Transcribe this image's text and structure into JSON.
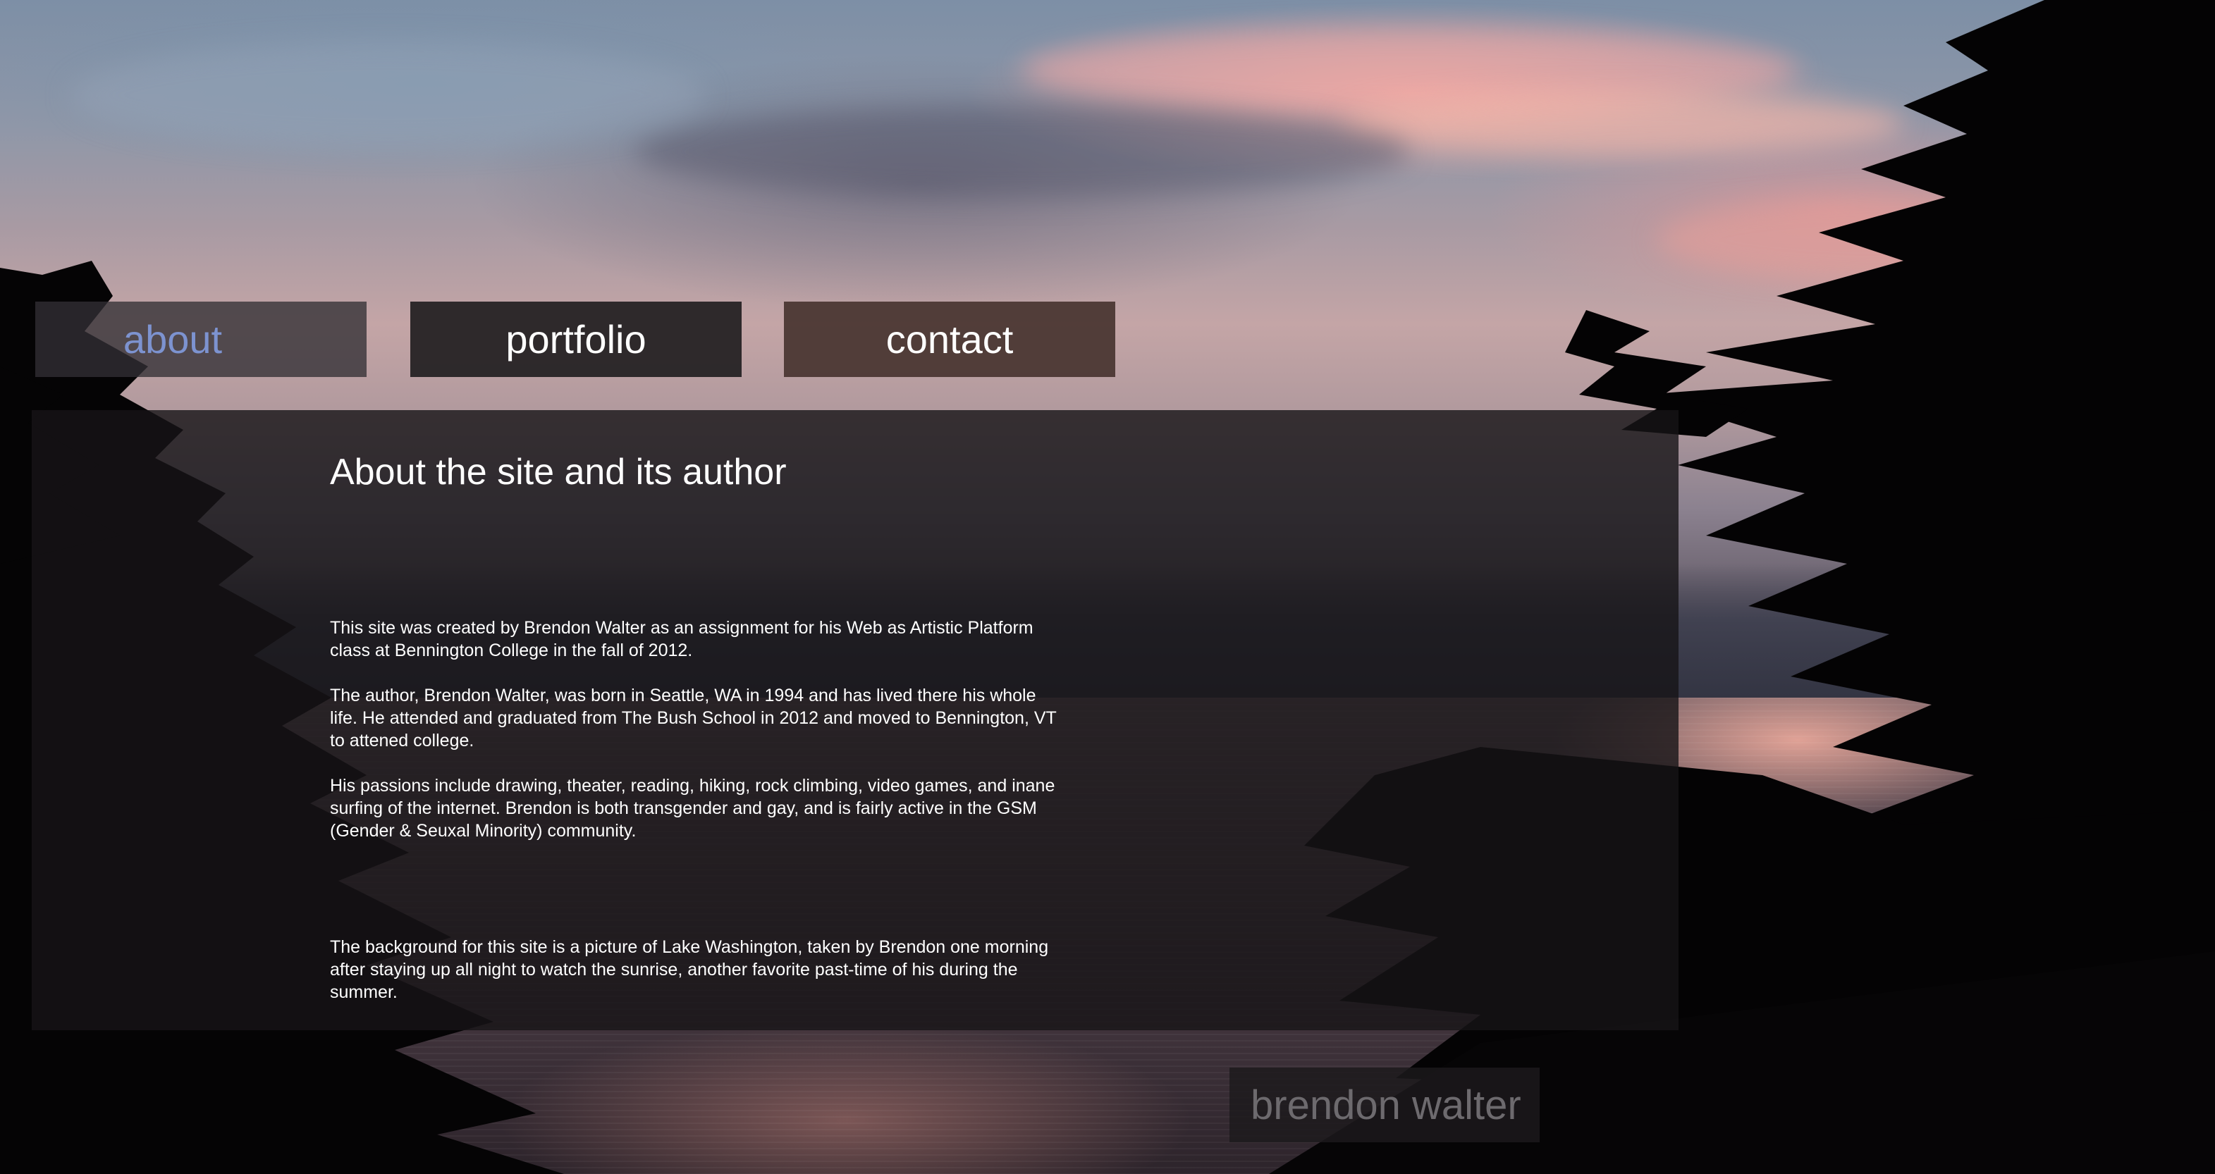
{
  "nav": {
    "items": [
      {
        "label": "about",
        "active": true
      },
      {
        "label": "portfolio",
        "active": false
      },
      {
        "label": "contact",
        "active": false
      }
    ],
    "active_color": "#7d93d0",
    "default_color": "#ffffff"
  },
  "content": {
    "title": "About the site and its author",
    "paragraphs": [
      "This site was created by Brendon Walter as an assignment for his Web as Artistic Platform class at Bennington College in the fall of 2012.",
      "The author, Brendon Walter, was born in Seattle, WA in 1994 and has lived there his whole life. He attended and graduated from The Bush School in 2012 and moved to Bennington, VT to attened college.",
      "His passions include drawing, theater, reading, hiking, rock climbing, video games, and inane surfing of the internet. Brendon is both transgender and gay, and is fairly active in the GSM (Gender & Seuxal Minority) community.",
      "The background for this site is a picture of Lake Washington, taken by Brendon one morning after staying up all night to watch the sunrise, another favorite past-time of his during the summer."
    ]
  },
  "footer": {
    "name": "brendon walter"
  },
  "background": {
    "subject": "sunrise-over-lake-photo"
  }
}
